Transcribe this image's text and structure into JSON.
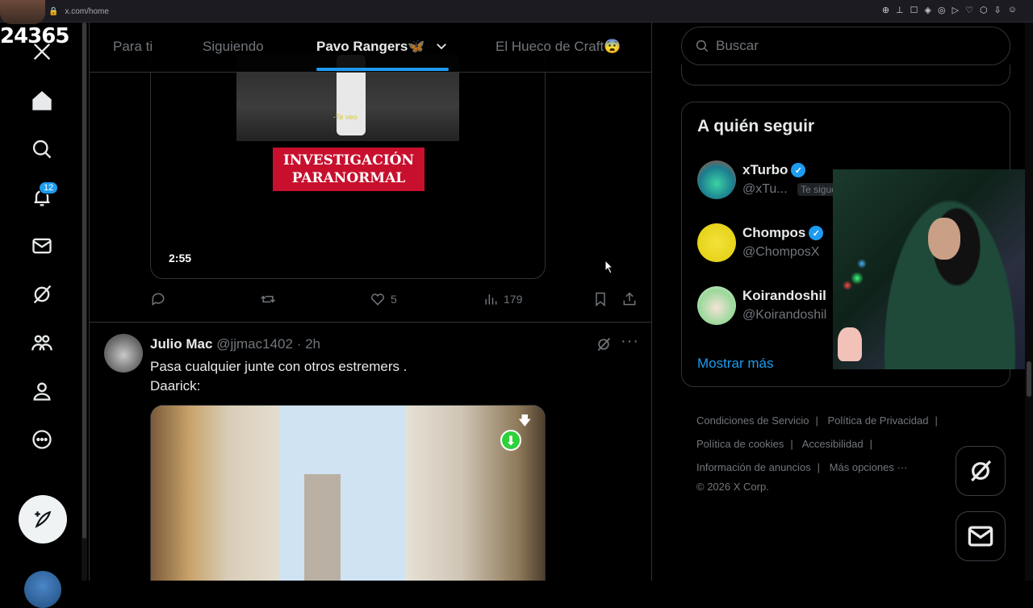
{
  "browser": {
    "url": "x.com/home"
  },
  "overlay": {
    "counter": "24365"
  },
  "nav": {
    "notifications_badge": "12",
    "icons": [
      "x-logo-icon",
      "home-icon",
      "search-icon",
      "bell-icon",
      "mail-icon",
      "grok-icon",
      "communities-icon",
      "profile-icon",
      "more-icon"
    ]
  },
  "tabs": [
    {
      "label": "Para ti",
      "active": false
    },
    {
      "label": "Siguiendo",
      "active": false
    },
    {
      "label": "Pavo Rangers🦋",
      "active": true
    },
    {
      "label": "El Hueco de Craft😨",
      "active": false
    }
  ],
  "tweet1": {
    "video_subtitle": "-Te veo",
    "video_label_line1": "INVESTIGACIÓN",
    "video_label_line2": "PARANORMAL",
    "duration": "2:55",
    "likes": "5",
    "views": "179"
  },
  "tweet2": {
    "name": "Julio Mac",
    "handle": "@jjmac1402",
    "time": "· 2h",
    "text": "Pasa cualquier junte con otros estremers .\nDaarick:"
  },
  "search": {
    "placeholder": "Buscar"
  },
  "who_to_follow": {
    "title": "A quién seguir",
    "users": [
      {
        "name": "xTurbo",
        "handle": "@xTu...",
        "follows_you": "Te sigue",
        "verified": true
      },
      {
        "name": "Chompos",
        "handle": "@ChomposX",
        "verified": true
      },
      {
        "name": "Koirandoshil",
        "handle": "@Koirandoshil",
        "verified": false
      }
    ],
    "show_more": "Mostrar más"
  },
  "footer": {
    "terms": "Condiciones de Servicio",
    "privacy": "Política de Privacidad",
    "cookies": "Política de cookies",
    "accessibility": "Accesibilidad",
    "ads_info": "Información de anuncios",
    "more": "Más opciones ···",
    "copyright": "© 2026 X Corp."
  },
  "colors": {
    "accent": "#1d9bf0",
    "background": "#000000",
    "text": "#e7e9ea",
    "muted": "#71767b",
    "label_red": "#c8102e"
  }
}
